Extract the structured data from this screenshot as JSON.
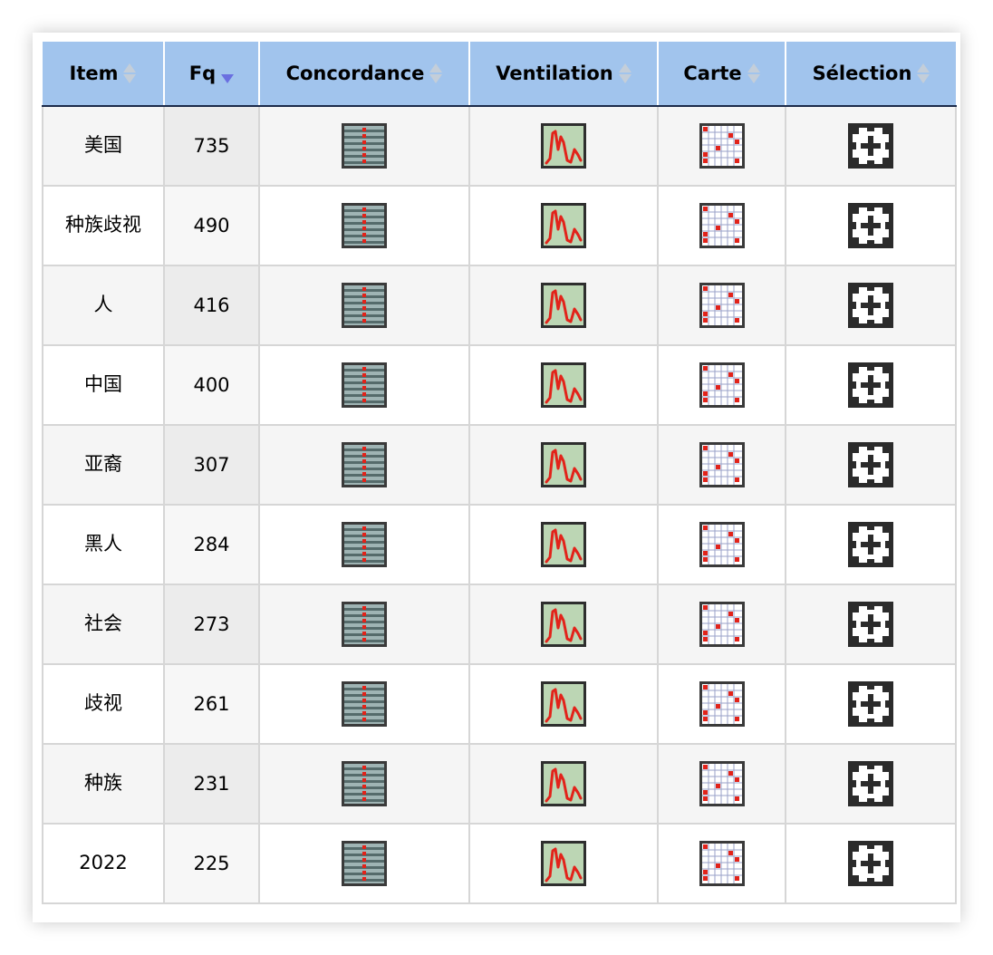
{
  "table": {
    "headers": [
      {
        "key": "item",
        "label": "Item",
        "sort": "both"
      },
      {
        "key": "fq",
        "label": "Fq",
        "sort": "desc"
      },
      {
        "key": "concordance",
        "label": "Concordance",
        "sort": "both"
      },
      {
        "key": "ventilation",
        "label": "Ventilation",
        "sort": "both"
      },
      {
        "key": "carte",
        "label": "Carte",
        "sort": "both"
      },
      {
        "key": "selection",
        "label": "Sélection",
        "sort": "both"
      }
    ],
    "rows": [
      {
        "item": "美国",
        "fq": "735"
      },
      {
        "item": "种族歧视",
        "fq": "490"
      },
      {
        "item": "人",
        "fq": "416"
      },
      {
        "item": "中国",
        "fq": "400"
      },
      {
        "item": "亚裔",
        "fq": "307"
      },
      {
        "item": "黑人",
        "fq": "284"
      },
      {
        "item": "社会",
        "fq": "273"
      },
      {
        "item": "歧视",
        "fq": "261"
      },
      {
        "item": "种族",
        "fq": "231"
      },
      {
        "item": "2022",
        "fq": "225"
      }
    ],
    "row_icons": [
      "concordance-icon",
      "ventilation-icon",
      "carte-icon",
      "selection-icon"
    ]
  },
  "colors": {
    "header_bg": "#a1c4ed",
    "sort_active": "#6a6fe0",
    "sort_inactive": "#c4ced9",
    "icon_red": "#e2231a"
  }
}
